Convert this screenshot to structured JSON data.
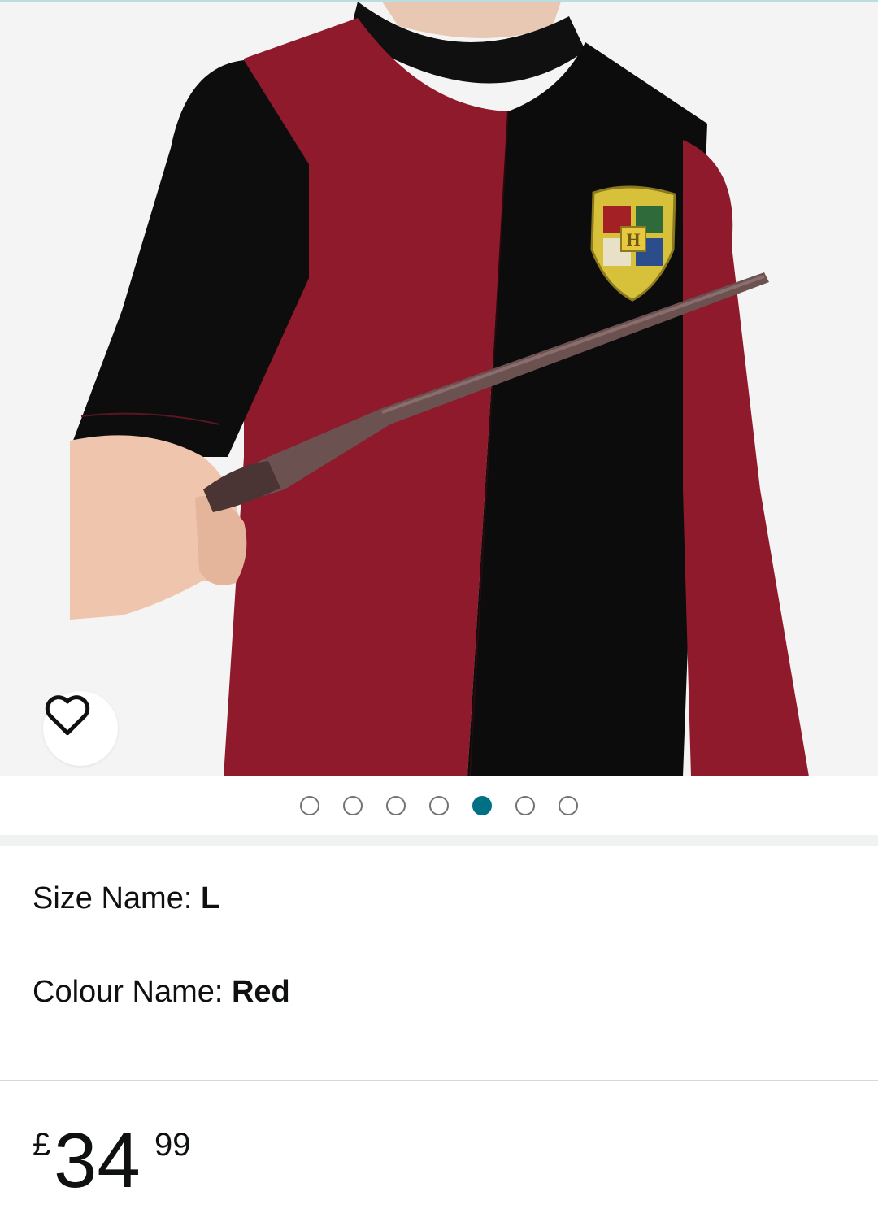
{
  "gallery": {
    "image_alt": "Child wearing red and black Hogwarts crest long-sleeve top holding a wand",
    "dots_total": 7,
    "active_index": 4,
    "active_color": "#007185"
  },
  "wishlist": {
    "icon": "heart-outline-icon"
  },
  "variations": {
    "size_label": "Size Name: ",
    "size_value": "L",
    "colour_label": "Colour Name: ",
    "colour_value": "Red"
  },
  "price": {
    "symbol": "£",
    "whole": "34",
    "fraction": "99"
  }
}
